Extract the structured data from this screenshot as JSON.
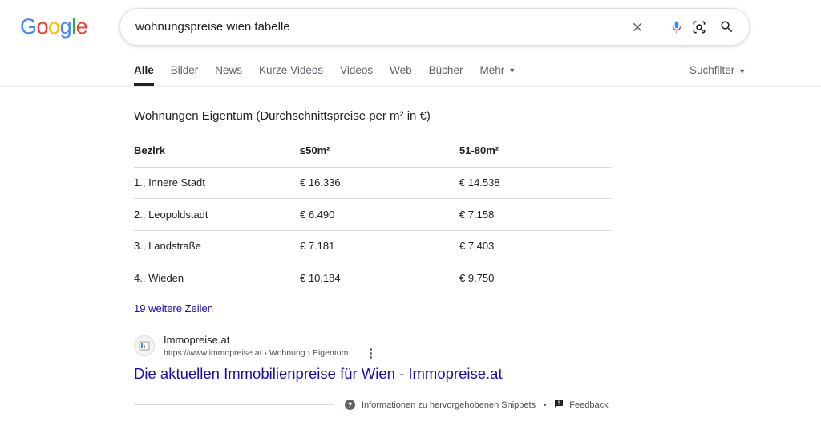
{
  "logo": {
    "letters": [
      "G",
      "o",
      "o",
      "g",
      "l",
      "e"
    ],
    "colors": [
      "#4285F4",
      "#EA4335",
      "#FBBC05",
      "#4285F4",
      "#34A853",
      "#EA4335"
    ]
  },
  "search": {
    "query": "wohnungspreise wien tabelle",
    "icons": [
      "clear-icon",
      "mic-icon",
      "camera-lens-icon",
      "search-icon"
    ]
  },
  "tabs": [
    {
      "label": "Alle",
      "active": true
    },
    {
      "label": "Bilder"
    },
    {
      "label": "News"
    },
    {
      "label": "Kurze Videos"
    },
    {
      "label": "Videos"
    },
    {
      "label": "Web"
    },
    {
      "label": "Bücher"
    },
    {
      "label": "Mehr",
      "dropdown": true
    }
  ],
  "tools": {
    "label": "Suchfilter"
  },
  "snippet": {
    "title": "Wohnungen Eigentum (Durchschnittspreise per m² in €)",
    "table": {
      "headers": [
        "Bezirk",
        "≤50m²",
        "51-80m²"
      ],
      "rows": [
        [
          "1., Innere Stadt",
          "€ 16.336",
          "€ 14.538"
        ],
        [
          "2., Leopoldstadt",
          "€ 6.490",
          "€ 7.158"
        ],
        [
          "3., Landstraße",
          "€ 7.181",
          "€ 7.403"
        ],
        [
          "4., Wieden",
          "€ 10.184",
          "€ 9.750"
        ]
      ]
    },
    "more_rows": "19 weitere Zeilen"
  },
  "source": {
    "site_name": "Immopreise.at",
    "url": "https://www.immopreise.at › Wohnung › Eigentum",
    "title": "Die aktuellen Immobilienpreise für Wien - Immopreise.at"
  },
  "footer": {
    "info_label": "Informationen zu hervorgehobenen Snippets",
    "separator": "•",
    "feedback_label": "Feedback"
  },
  "colors": {
    "link": "#1a0dab",
    "text": "#202124",
    "muted": "#5f6368"
  }
}
